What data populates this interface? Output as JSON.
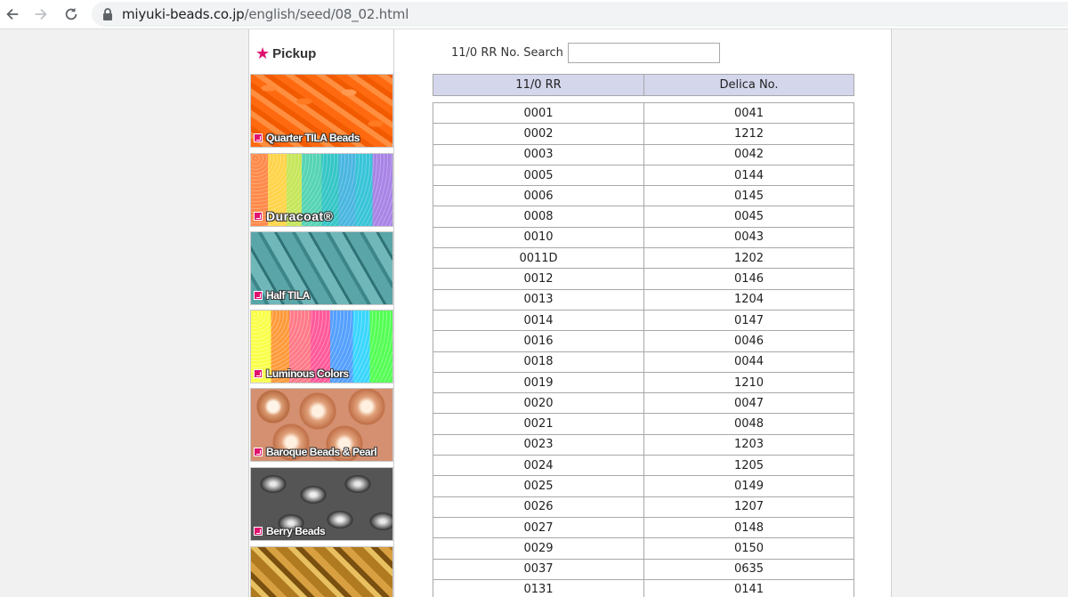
{
  "browser": {
    "url_host": "miyuki-beads.co.jp",
    "url_path": "/english/seed/08_02.html"
  },
  "sidebar": {
    "pickup_label": "Pickup",
    "banners": [
      {
        "label": "Quarter TILA Beads"
      },
      {
        "label": "Duracoat®"
      },
      {
        "label": "Half TILA"
      },
      {
        "label": "Luminous Colors"
      },
      {
        "label": "Baroque Beads & Pearl"
      },
      {
        "label": "Berry Beads"
      },
      {
        "label": ""
      }
    ]
  },
  "search": {
    "label": "11/0 RR No. Search",
    "value": ""
  },
  "table": {
    "headers": [
      "11/0 RR",
      "Delica No."
    ],
    "rows": [
      [
        "0001",
        "0041"
      ],
      [
        "0002",
        "1212"
      ],
      [
        "0003",
        "0042"
      ],
      [
        "0005",
        "0144"
      ],
      [
        "0006",
        "0145"
      ],
      [
        "0008",
        "0045"
      ],
      [
        "0010",
        "0043"
      ],
      [
        "0011D",
        "1202"
      ],
      [
        "0012",
        "0146"
      ],
      [
        "0013",
        "1204"
      ],
      [
        "0014",
        "0147"
      ],
      [
        "0016",
        "0046"
      ],
      [
        "0018",
        "0044"
      ],
      [
        "0019",
        "1210"
      ],
      [
        "0020",
        "0047"
      ],
      [
        "0021",
        "0048"
      ],
      [
        "0023",
        "1203"
      ],
      [
        "0024",
        "1205"
      ],
      [
        "0025",
        "0149"
      ],
      [
        "0026",
        "1207"
      ],
      [
        "0027",
        "0148"
      ],
      [
        "0029",
        "0150"
      ],
      [
        "0037",
        "0635"
      ],
      [
        "0131",
        "0141"
      ]
    ]
  }
}
